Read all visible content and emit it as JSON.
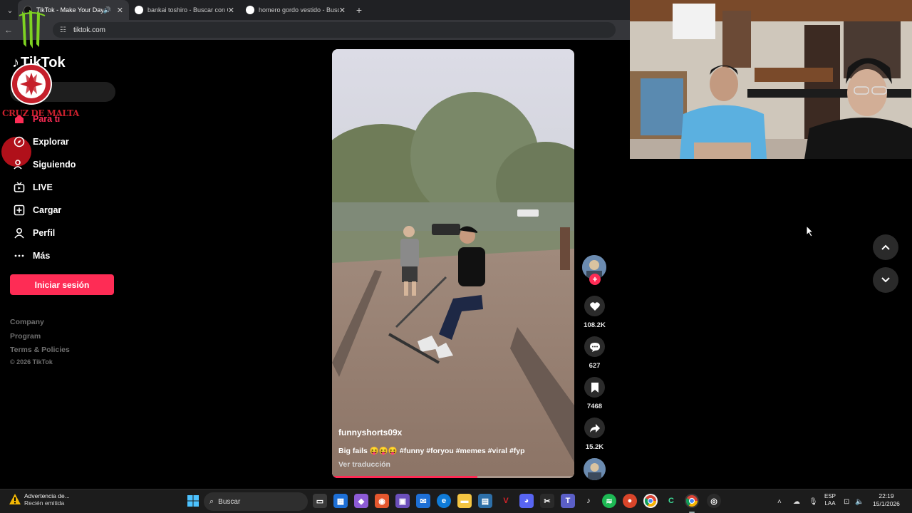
{
  "browser": {
    "tabs": [
      {
        "title": "TikTok - Make Your Day",
        "active": true,
        "favicon_color": "#000000"
      },
      {
        "title": "bankai toshiro - Buscar con Go",
        "active": false,
        "favicon_color": "#ffffff"
      },
      {
        "title": "homero gordo vestido - Buscar",
        "active": false,
        "favicon_color": "#ffffff"
      }
    ],
    "url": "tiktok.com"
  },
  "overlay": {
    "cruz_text": "CRUZ DE MALTA"
  },
  "sidebar": {
    "logo": "TikTok",
    "items": [
      {
        "label": "Para ti",
        "icon": "home-icon"
      },
      {
        "label": "Explorar",
        "icon": "compass-icon"
      },
      {
        "label": "Siguiendo",
        "icon": "following-icon"
      },
      {
        "label": "LIVE",
        "icon": "live-icon"
      },
      {
        "label": "Cargar",
        "icon": "upload-icon"
      },
      {
        "label": "Perfil",
        "icon": "profile-icon"
      },
      {
        "label": "Más",
        "icon": "more-icon"
      }
    ],
    "login_label": "Iniciar sesión",
    "footer_links": [
      "Company",
      "Program",
      "Terms & Policies"
    ],
    "copyright": "© 2026 TikTok"
  },
  "video": {
    "author": "funnyshorts09x",
    "caption": "Big fails 😝😝😝 #funny #foryou #memes #viral #fyp",
    "translate_label": "Ver traducción",
    "progress": 0.6
  },
  "actions": {
    "likes": "108.2K",
    "comments": "627",
    "saves": "7468",
    "shares": "15.2K"
  },
  "taskbar": {
    "notification_title": "Advertencia de...",
    "notification_sub": "Recién emitida",
    "search_placeholder": "Buscar",
    "lang_top": "ESP",
    "lang_bottom": "LAA",
    "time": "22:19",
    "date": "15/1/2026"
  },
  "colors": {
    "accent": "#fe2c55",
    "background": "#000000"
  }
}
